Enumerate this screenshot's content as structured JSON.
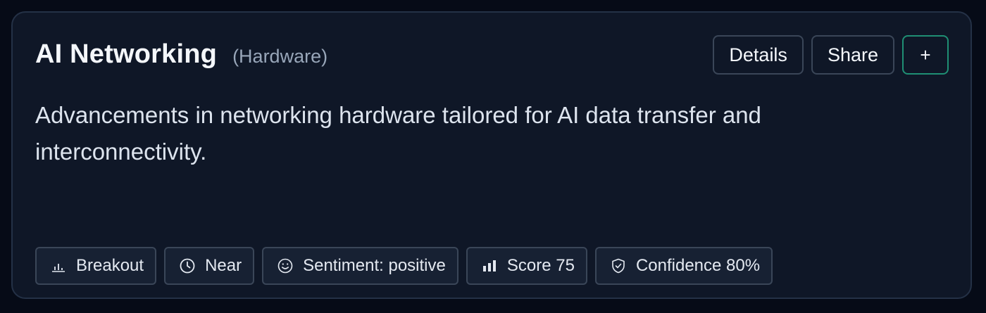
{
  "card": {
    "title": "AI Networking",
    "category": "(Hardware)",
    "description": "Advancements in networking hardware tailored for AI data transfer and interconnectivity.",
    "actions": {
      "details_label": "Details",
      "share_label": "Share",
      "add_label": "+"
    },
    "tags": [
      {
        "icon": "bar-chart-low-icon",
        "label": "Breakout"
      },
      {
        "icon": "clock-icon",
        "label": "Near"
      },
      {
        "icon": "smile-icon",
        "label": "Sentiment: positive"
      },
      {
        "icon": "bar-chart-icon",
        "label": "Score 75"
      },
      {
        "icon": "shield-check-icon",
        "label": "Confidence 80%"
      }
    ]
  },
  "colors": {
    "background": "#060b17",
    "card": "#0f1727",
    "border": "#243146",
    "accent": "#1f8f74",
    "text": "#f4f7fb",
    "muted": "#98a6b9"
  }
}
